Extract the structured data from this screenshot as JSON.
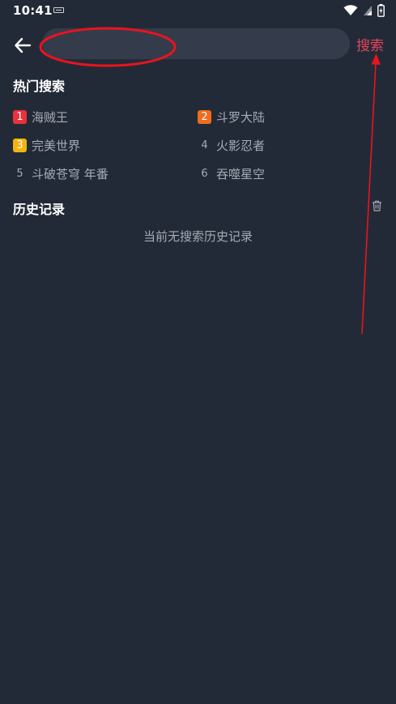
{
  "status_bar": {
    "time": "10:41"
  },
  "header": {
    "back_icon": "arrow-left-icon",
    "search_value": "",
    "search_placeholder": "",
    "search_label": "搜索"
  },
  "hot": {
    "title": "热门搜索",
    "items": [
      {
        "rank": "1",
        "label": "海贼王",
        "badge_color": "#e8323c"
      },
      {
        "rank": "2",
        "label": "斗罗大陆",
        "badge_color": "#f26b1d"
      },
      {
        "rank": "3",
        "label": "完美世界",
        "badge_color": "#f2b40f"
      },
      {
        "rank": "4",
        "label": "火影忍者",
        "badge_color": ""
      },
      {
        "rank": "5",
        "label": "斗破苍穹 年番",
        "badge_color": ""
      },
      {
        "rank": "6",
        "label": "吞噬星空",
        "badge_color": ""
      }
    ]
  },
  "history": {
    "title": "历史记录",
    "empty_text": "当前无搜索历史记录",
    "clear_icon": "trash-icon"
  },
  "colors": {
    "background": "#232a37",
    "search_field": "#343b4b",
    "accent": "#e2455a",
    "muted_text": "#a6abb4",
    "annotation": "#e8141e"
  }
}
